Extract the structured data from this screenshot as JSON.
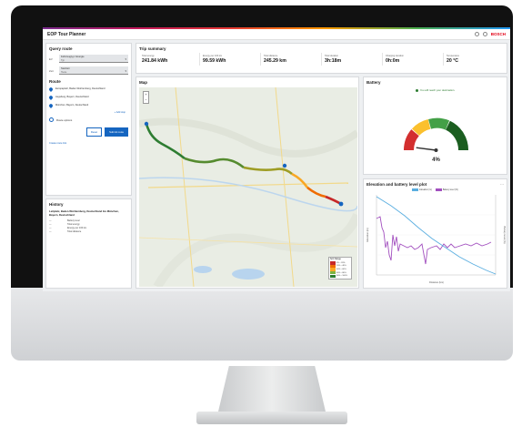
{
  "app": {
    "title": "EOP Tour Planner",
    "brand": "BOSCH"
  },
  "colors": {
    "accent": "#1565c0",
    "brand": "#e20015",
    "route_green": "#2e7d32",
    "route_red": "#c62828"
  },
  "query": {
    "title": "Query route",
    "fields": [
      {
        "label": "EV",
        "value": "Fahrzeugtyp / Energie",
        "sub": "Typ"
      },
      {
        "label": "Zeit",
        "value": "Startzeit",
        "sub": "Heute"
      }
    ]
  },
  "route": {
    "title": "Route",
    "stops": [
      "Europaplatz, Baden-Württemberg, Deutschland",
      "Augsburg, Bayern, Deutschland",
      "München, Bayern, Deutschland"
    ],
    "add_stop": "+ Add stop",
    "options_label": "Route options",
    "reset_label": "Reset",
    "submit_label": "Submit route",
    "link_label": "Create route link"
  },
  "history": {
    "title": "History",
    "address": "Leitplatz, Baden-Württemberg, Deutschland bis München, Bayern, Deutschland",
    "rows": [
      [
        "—",
        "Battery level"
      ],
      [
        "—",
        "Total energy"
      ],
      [
        "—",
        "Energy per 100 km"
      ],
      [
        "—",
        "Total distance"
      ]
    ]
  },
  "trip": {
    "title": "Trip summary",
    "tiles": [
      {
        "label": "Total energy",
        "value": "241.84 kWh"
      },
      {
        "label": "Energy per 100 km",
        "value": "99.59 kWh"
      },
      {
        "label": "Total distance",
        "value": "245.29 km"
      },
      {
        "label": "Total duration",
        "value": "3h:18m"
      },
      {
        "label": "Charging duration",
        "value": "0h:0m"
      },
      {
        "label": "Temperature",
        "value": "20 °C"
      }
    ]
  },
  "map": {
    "title": "Map",
    "legend_title": "SoC Range",
    "legend": [
      {
        "label": "0% - 20%",
        "color": "#c62828"
      },
      {
        "label": "20% - 40%",
        "color": "#ef6c00"
      },
      {
        "label": "40% - 60%",
        "color": "#f9a825"
      },
      {
        "label": "60% - 80%",
        "color": "#7cb342"
      },
      {
        "label": "80% - 100%",
        "color": "#2e7d32"
      }
    ]
  },
  "battery": {
    "title": "Battery",
    "status": "You will reach your destination.",
    "level_text": "4%",
    "level": 4
  },
  "elevation": {
    "title": "Elevation and battery level plot",
    "series_elevation": "Elevation (m)",
    "series_battery": "Battery level (%)",
    "ylabel_left": "Elevation (m)",
    "ylabel_right": "Battery level (%)",
    "xlabel": "Distance (km)"
  }
}
